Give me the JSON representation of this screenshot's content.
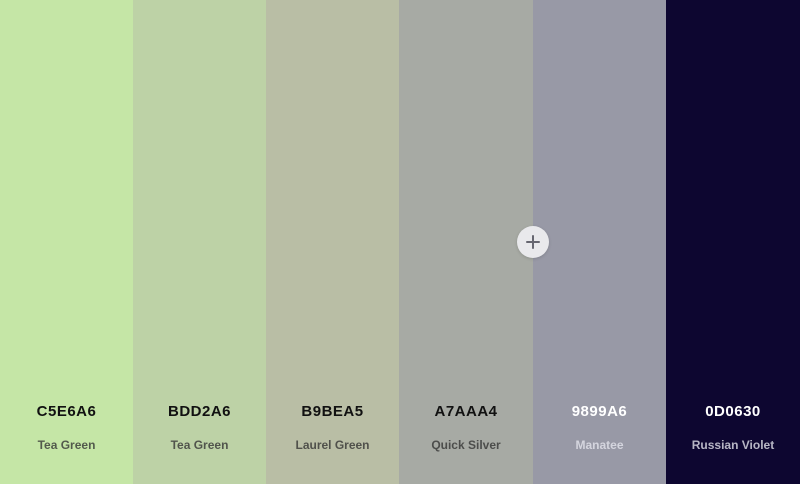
{
  "palette": {
    "swatches": [
      {
        "hex": "C5E6A6",
        "name": "Tea Green",
        "color": "#C5E6A6"
      },
      {
        "hex": "BDD2A6",
        "name": "Tea Green",
        "color": "#BDD2A6"
      },
      {
        "hex": "B9BEA5",
        "name": "Laurel Green",
        "color": "#B9BEA5"
      },
      {
        "hex": "A7AAA4",
        "name": "Quick Silver",
        "color": "#A7AAA4"
      },
      {
        "hex": "9899A6",
        "name": "Manatee",
        "color": "#9899A6"
      },
      {
        "hex": "0D0630",
        "name": "Russian Violet",
        "color": "#0D0630"
      }
    ],
    "add_button_icon": "plus-icon"
  }
}
